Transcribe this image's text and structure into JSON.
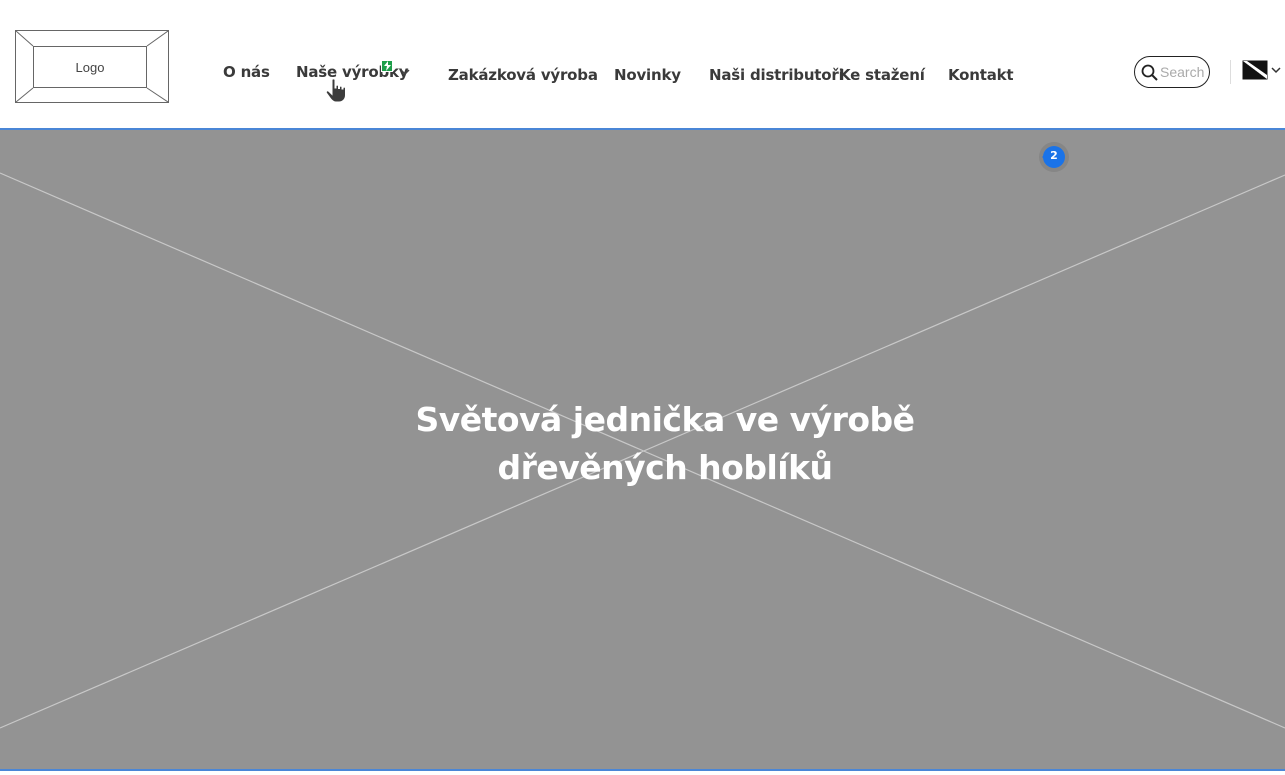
{
  "logo": {
    "label": "Logo"
  },
  "nav": {
    "items": [
      {
        "label": "O nás"
      },
      {
        "label": "Naše výrobky"
      },
      {
        "label": "Zakázková výroba"
      },
      {
        "label": "Novinky"
      },
      {
        "label": "Naši distributoři"
      },
      {
        "label": "Ke stažení"
      },
      {
        "label": "Kontakt"
      }
    ]
  },
  "search": {
    "placeholder": "Search"
  },
  "hero": {
    "title_line1": "Světová jednička ve výrobě",
    "title_line2": "dřevěných hoblíků"
  },
  "comment": {
    "count": "2",
    "color": "#1a73e8"
  },
  "colors": {
    "hero_bg": "#939393",
    "accent_border": "#4a86d6",
    "badge_green": "#1e9e4a"
  },
  "icons": [
    "search-icon",
    "flag-icon",
    "chevron-down-icon",
    "hand-cursor-icon",
    "lightning-icon",
    "comment-pin-icon"
  ]
}
